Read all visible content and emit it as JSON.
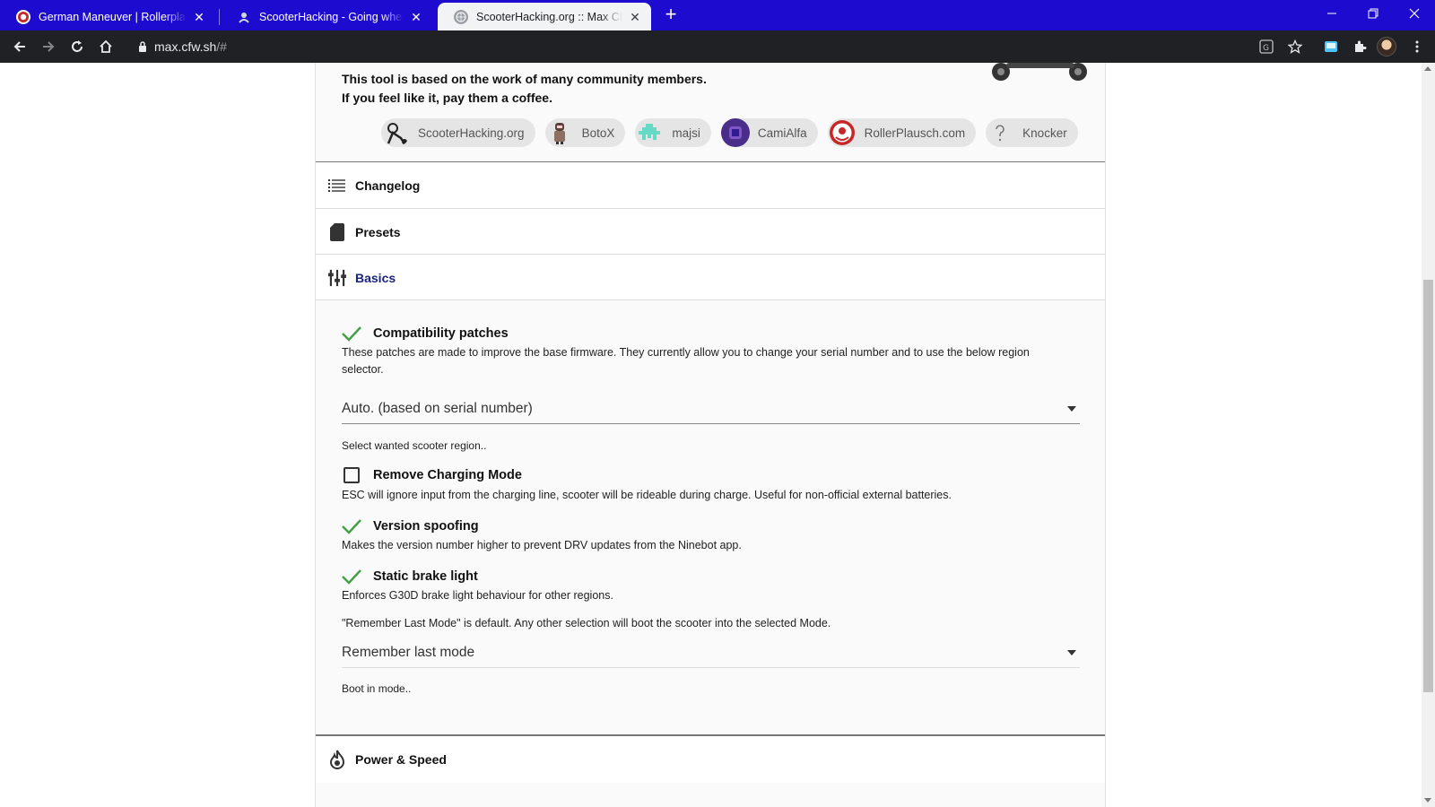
{
  "browser": {
    "tabs": [
      {
        "title": "German Maneuver | Rollerplausch",
        "active": false
      },
      {
        "title": "ScooterHacking - Going where n",
        "active": false
      },
      {
        "title": "ScooterHacking.org :: Max CFW B",
        "active": true
      }
    ],
    "new_tab_icon": "plus-icon",
    "url_host": "max.cfw.sh",
    "url_path": "/#"
  },
  "intro": {
    "line1": "This tool is based on the work of many community members.",
    "line2": "If you feel like it, pay them a coffee."
  },
  "contributors": [
    {
      "name": "ScooterHacking.org",
      "icon": "scooterhacking-logo-icon"
    },
    {
      "name": "BotoX",
      "icon": "botox-avatar-icon"
    },
    {
      "name": "majsi",
      "icon": "majsi-avatar-icon"
    },
    {
      "name": "CamiAlfa",
      "icon": "camialfa-avatar-icon"
    },
    {
      "name": "RollerPlausch.com",
      "icon": "rollerplausch-logo-icon"
    },
    {
      "name": "Knocker",
      "icon": "question-mark-icon"
    }
  ],
  "sections": {
    "changelog": "Changelog",
    "presets": "Presets",
    "basics": "Basics",
    "power_speed": "Power & Speed"
  },
  "basics": {
    "compat": {
      "title": "Compatibility patches",
      "checked": true,
      "desc": "These patches are made to improve the base firmware. They currently allow you to change your serial number and to use the below region selector."
    },
    "region_select": {
      "value": "Auto. (based on serial number)",
      "hint": "Select wanted scooter region.."
    },
    "charging": {
      "title": "Remove Charging Mode",
      "checked": false,
      "desc": "ESC will ignore input from the charging line, scooter will be rideable during charge. Useful for non-official external batteries."
    },
    "spoof": {
      "title": "Version spoofing",
      "checked": true,
      "desc": "Makes the version number higher to prevent DRV updates from the Ninebot app."
    },
    "brake": {
      "title": "Static brake light",
      "checked": true,
      "desc": "Enforces G30D brake light behaviour for other regions."
    },
    "mode_note": "\"Remember Last Mode\" is default. Any other selection will boot the scooter into the selected Mode.",
    "mode_select": {
      "value": "Remember last mode",
      "hint": "Boot in mode.."
    }
  },
  "colors": {
    "tabstrip": "#1e0bd0",
    "toolbar": "#202124",
    "check_green": "#43a047",
    "active_section": "#1a237e"
  }
}
